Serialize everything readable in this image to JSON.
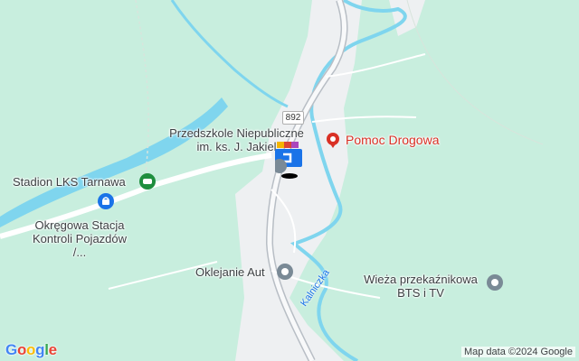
{
  "route_label": "892",
  "river_label": "Kalniczka",
  "places": {
    "pomoc": "Pomoc Drogowa",
    "przedszkole": "Przedszkole Niepubliczne\nim. ks. J. Jakiel",
    "stadion": "Stadion LKS Tarnawa",
    "okregowa": "Okręgowa Stacja\nKontroli Pojazdów /...",
    "oklejanie": "Oklejanie Aut",
    "wieza": "Wieża przekaźnikowa\nBTS i TV"
  },
  "attribution": "Map data ©2024 Google",
  "logo": [
    "G",
    "o",
    "o",
    "g",
    "l",
    "e"
  ],
  "colors": {
    "land": "#c8eede",
    "water": "#7fd5ee",
    "road": "#ffffff",
    "settlement": "#eef0f2",
    "poi_red": "#d93025",
    "poi_gray": "#7a8a96",
    "poi_green": "#1e8e3e"
  },
  "icons": [
    "pin-red-icon",
    "school-icon",
    "stadium-icon",
    "inspection-icon",
    "service-icon",
    "tower-icon",
    "street-view-icon"
  ]
}
